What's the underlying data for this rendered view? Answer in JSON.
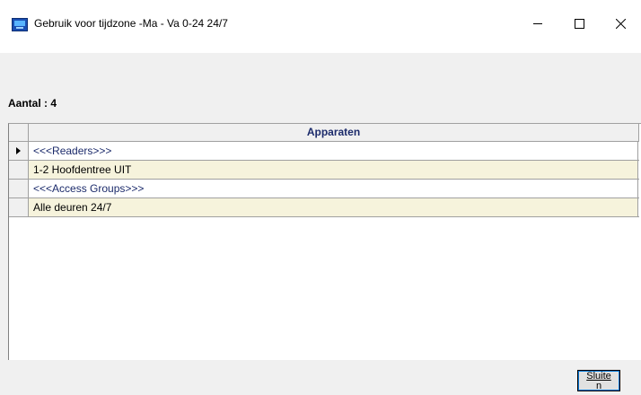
{
  "window": {
    "title": "Gebruik voor tijdzone -Ma - Va 0-24 24/7",
    "icon": "app-monitor-icon",
    "controls": [
      "minimize-icon",
      "maximize-icon",
      "close-icon"
    ]
  },
  "summary": {
    "count_label": "Aantal : 4"
  },
  "grid": {
    "column_header": "Apparaten",
    "rows": [
      {
        "text": "<<<Readers>>>",
        "color": "#1c2b6b",
        "current": true
      },
      {
        "text": "1-2  Hoofdentree UIT",
        "color": "#000000",
        "current": false
      },
      {
        "text": "<<<Access Groups>>>",
        "color": "#1c2b6b",
        "current": false
      },
      {
        "text": "Alle deuren 24/7",
        "color": "#000000",
        "current": false
      }
    ]
  },
  "buttons": {
    "close_label_line1": "Sluite",
    "close_label_line2": "n"
  }
}
